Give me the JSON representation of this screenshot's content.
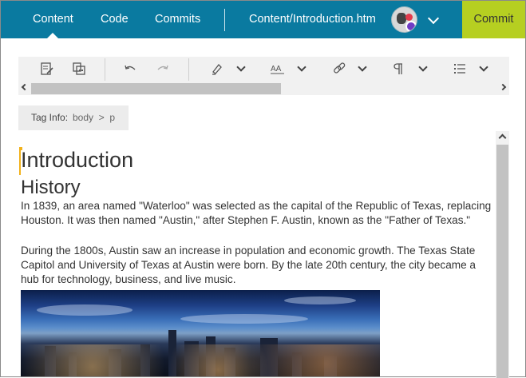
{
  "topbar": {
    "tabs": [
      {
        "label": "Content",
        "active": true
      },
      {
        "label": "Code",
        "active": false
      },
      {
        "label": "Commits",
        "active": false
      }
    ],
    "file_path": "Content/Introduction.htm",
    "commit_label": "Commit",
    "colors": {
      "bar": "#0a7aa0",
      "commit": "#b6cf21"
    }
  },
  "toolbar": {
    "icons": [
      "edit-document-icon",
      "copy-format-icon",
      "undo-icon",
      "redo-icon",
      "highlighter-icon",
      "font-size-icon",
      "link-icon",
      "paragraph-icon",
      "list-icon"
    ]
  },
  "tag_info": {
    "label": "Tag Info:",
    "path": "body  >  p"
  },
  "document": {
    "heading1": "Introduction",
    "heading2": "History",
    "paragraphs": [
      "In 1839, an area named \"Waterloo\" was selected as the capital of the Republic of Texas, replacing Houston. It was then named \"Austin,\" after Stephen F. Austin, known as the \"Father of Texas.\"",
      "During the 1800s, Austin saw an increase in population and economic growth. The Texas State Capitol and University of Texas at Austin were born. By the late 20th century, the city became a hub for technology, business, and live music."
    ],
    "image": "austin-skyline-image"
  }
}
